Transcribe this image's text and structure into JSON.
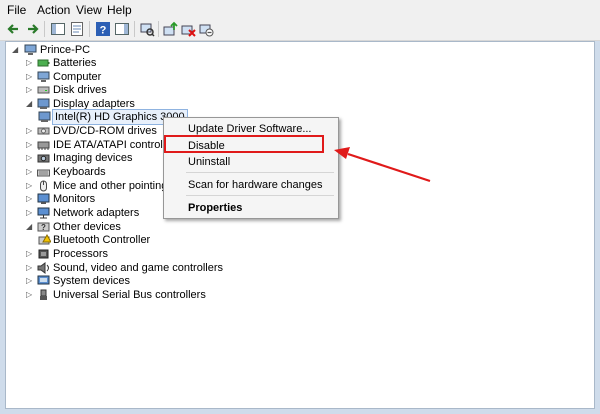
{
  "menu": {
    "items": [
      "File",
      "Action",
      "View",
      "Help"
    ]
  },
  "toolbar": {
    "icons": [
      "back-arrow-icon",
      "forward-arrow-icon",
      "show-hide-tree-icon",
      "properties-icon",
      "help-icon",
      "show-hide-action-pane-icon",
      "scan-hardware-icon",
      "update-driver-icon",
      "uninstall-device-icon",
      "disable-device-icon"
    ]
  },
  "tree": {
    "root": "Prince-PC",
    "items": [
      "Batteries",
      "Computer",
      "Disk drives",
      "Display adapters",
      "Intel(R) HD Graphics 3000",
      "DVD/CD-ROM drives",
      "IDE ATA/ATAPI controllers",
      "Imaging devices",
      "Keyboards",
      "Mice and other pointing de",
      "Monitors",
      "Network adapters",
      "Other devices",
      "Bluetooth Controller",
      "Processors",
      "Sound, video and game controllers",
      "System devices",
      "Universal Serial Bus controllers"
    ]
  },
  "context_menu": {
    "update": "Update Driver Software...",
    "disable": "Disable",
    "uninstall": "Uninstall",
    "scan": "Scan for hardware changes",
    "properties": "Properties"
  },
  "colors": {
    "highlight": "#e01a1a",
    "arrow": "#e01a1a"
  }
}
